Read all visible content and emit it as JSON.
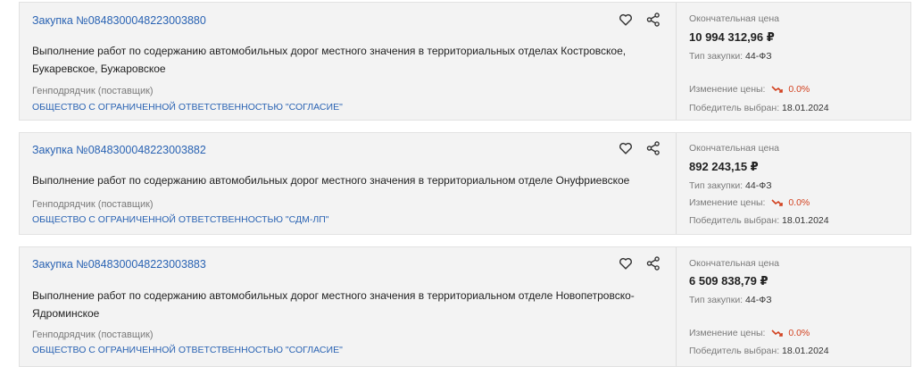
{
  "labels": {
    "contractor": "Генподрядчик (поставщик)",
    "final_price": "Окончательная цена",
    "purchase_type": "Тип закупки:",
    "price_change": "Изменение цены:",
    "winner_chosen": "Победитель выбран:"
  },
  "icons": {
    "favorite": "heart-icon",
    "share": "share-icon",
    "trend": "trend-down-icon"
  },
  "colors": {
    "link": "#2a63b3",
    "negative": "#d2401e",
    "card_bg": "#f3f3f3"
  },
  "cards": [
    {
      "title": "Закупка №0848300048223003880",
      "description": "Выполнение работ по содержанию автомобильных дорог местного значения в территориальных отделах Костровское, Букаревское, Бужаровское",
      "company": "ОБЩЕСТВО С ОГРАНИЧЕННОЙ ОТВЕТСТВЕННОСТЬЮ \"СОГЛАСИЕ\"",
      "price": "10 994 312,96 ₽",
      "purchase_type": "44-ФЗ",
      "price_change": "0.0%",
      "winner_date": "18.01.2024"
    },
    {
      "title": "Закупка №0848300048223003882",
      "description": "Выполнение работ по содержанию автомобильных дорог местного значения в территориальном отделе Онуфриевское",
      "company": "ОБЩЕСТВО С ОГРАНИЧЕННОЙ ОТВЕТСТВЕННОСТЬЮ \"СДМ-ЛП\"",
      "price": "892 243,15 ₽",
      "purchase_type": "44-ФЗ",
      "price_change": "0.0%",
      "winner_date": "18.01.2024"
    },
    {
      "title": "Закупка №0848300048223003883",
      "description": "Выполнение работ по содержанию автомобильных дорог местного значения в территориальном отделе Новопетровско-Ядроминское",
      "company": "ОБЩЕСТВО С ОГРАНИЧЕННОЙ ОТВЕТСТВЕННОСТЬЮ \"СОГЛАСИЕ\"",
      "price": "6 509 838,79 ₽",
      "purchase_type": "44-ФЗ",
      "price_change": "0.0%",
      "winner_date": "18.01.2024"
    }
  ]
}
